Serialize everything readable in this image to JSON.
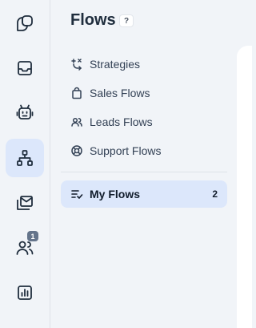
{
  "rail": {
    "items": [
      {
        "icon": "chat-bubbles-icon",
        "active": false
      },
      {
        "icon": "inbox-icon",
        "active": false
      },
      {
        "icon": "bot-icon",
        "active": false
      },
      {
        "icon": "flows-icon",
        "active": true
      },
      {
        "icon": "campaigns-icon",
        "active": false
      },
      {
        "icon": "contacts-icon",
        "active": false,
        "badge": "1"
      },
      {
        "icon": "reports-icon",
        "active": false
      }
    ],
    "contacts_badge": "1"
  },
  "panel": {
    "title": "Flows",
    "help_label": "?",
    "items": [
      {
        "label": "Strategies",
        "icon": "strategies-icon"
      },
      {
        "label": "Sales Flows",
        "icon": "shopping-bag-icon"
      },
      {
        "label": "Leads Flows",
        "icon": "users-icon"
      },
      {
        "label": "Support Flows",
        "icon": "lifebuoy-icon"
      }
    ],
    "my_flows": {
      "label": "My Flows",
      "count": "2",
      "icon": "list-check-icon"
    }
  },
  "colors": {
    "accent_bg": "#dce7fb",
    "text": "#1f2d3d",
    "rail_bg": "#f1f4f8"
  }
}
